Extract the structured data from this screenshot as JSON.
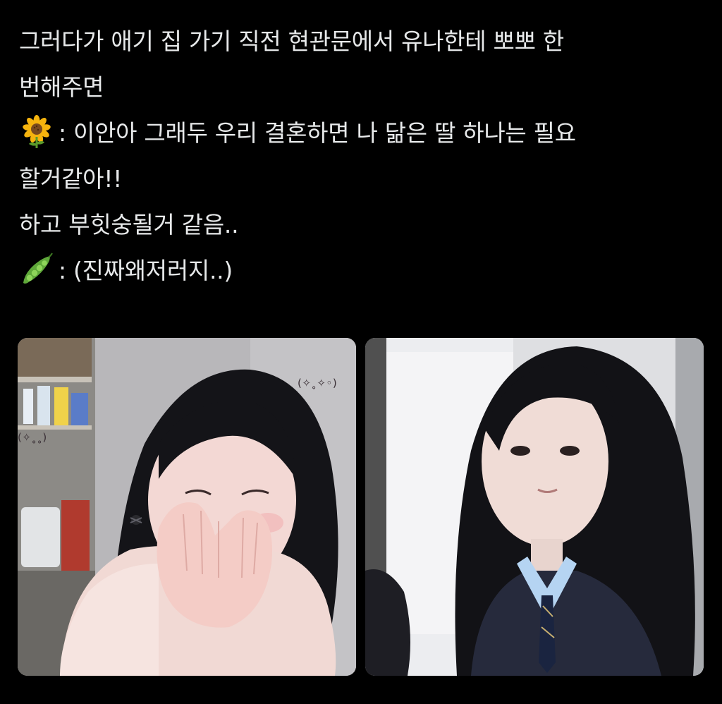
{
  "tweet": {
    "lines": [
      "그러다가 애기 집 가기 직전 현관문에서 유나한테 뽀뽀 한",
      "번해주면",
      ": 이안아 그래두 우리 결혼하면 나 닮은 딸 하나는 필요",
      "할거같아!!",
      "하고 부힛숭될거 같음..",
      ": (진짜왜저러지..)"
    ],
    "speaker_emojis": {
      "first": "sunflower-icon",
      "second": "pea-pod-icon"
    }
  },
  "media": {
    "images": [
      {
        "description_name": "photo-girl-covering-face",
        "stickers": [
          "(✧˳✧◦)",
          "(✧˳˳)"
        ]
      },
      {
        "description_name": "photo-girl-school-uniform"
      }
    ]
  },
  "colors": {
    "background": "#000000",
    "text": "#e7e9ea"
  }
}
